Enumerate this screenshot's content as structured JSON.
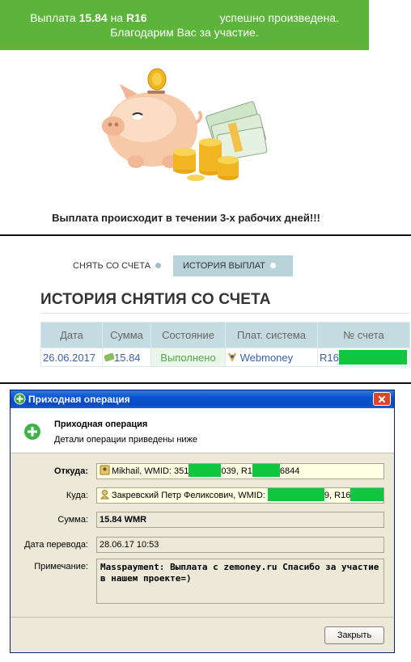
{
  "banner": {
    "line1_a": "Выплата",
    "amount": "15.84",
    "line1_b": "на",
    "purse_prefix": "R16",
    "line1_c": "успешно произведена.",
    "line2": "Благодарим Вас за участие."
  },
  "notice": "Выплата происходит в течении 3-х рабочих дней!!!",
  "tabs": {
    "withdraw": "СНЯТЬ СО СЧЕТА",
    "history": "ИСТОРИЯ ВЫПЛАТ"
  },
  "history": {
    "title": "ИСТОРИЯ СНЯТИЯ СО СЧЕТА",
    "columns": [
      "Дата",
      "Сумма",
      "Состояние",
      "Плат. система",
      "№ счета"
    ],
    "row": {
      "date": "26.06.2017",
      "amount": "15.84",
      "status": "Выполнено",
      "system": "Webmoney",
      "account": "R16"
    }
  },
  "window": {
    "title": "Приходная операция",
    "header_title": "Приходная операция",
    "header_subtitle": "Детали операции приведены ниже",
    "from_label": "Откуда:",
    "from_a": "Mikhail, WMID: 351",
    "from_b": "039, R1",
    "from_c": "6844",
    "to_label": "Куда:",
    "to_a": "Закревский Петр Феликсович, WMID:",
    "to_b": "9, R16",
    "sum_label": "Сумма:",
    "sum_value": "15.84 WMR",
    "date_label": "Дата перевода:",
    "date_value": "28.06.17 10:53",
    "note_label": "Примечание:",
    "note_value": "Masspayment: Выплата с zemoney.ru Спасибо за участие в нашем проекте=)",
    "close_label": "Закрыть"
  },
  "colors": {
    "banner_green": "#5cb53a",
    "tab_active": "#b9d3da",
    "table_header": "#c4dbe1",
    "status_green": "#5aa64a",
    "mask_green": "#10c63f",
    "xp_blue": "#0a52cf"
  }
}
